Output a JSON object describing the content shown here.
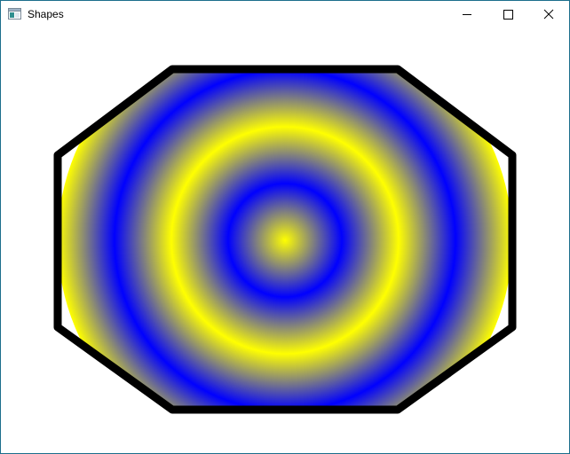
{
  "window": {
    "title": "Shapes",
    "icon": "app-window-icon",
    "controls": {
      "minimize_icon": "minimize-icon",
      "maximize_icon": "maximize-icon",
      "close_icon": "close-icon"
    }
  },
  "canvas": {
    "shapes": [
      {
        "kind": "octagon-outline",
        "stroke": "#000000"
      },
      {
        "kind": "concentric-rings-radial-gradient",
        "colors": [
          "#ffff00",
          "#0000ff"
        ]
      }
    ],
    "colors": {
      "yellow": "#ffff00",
      "blue": "#0000ff",
      "outline": "#000000",
      "background": "#ffffff"
    }
  }
}
